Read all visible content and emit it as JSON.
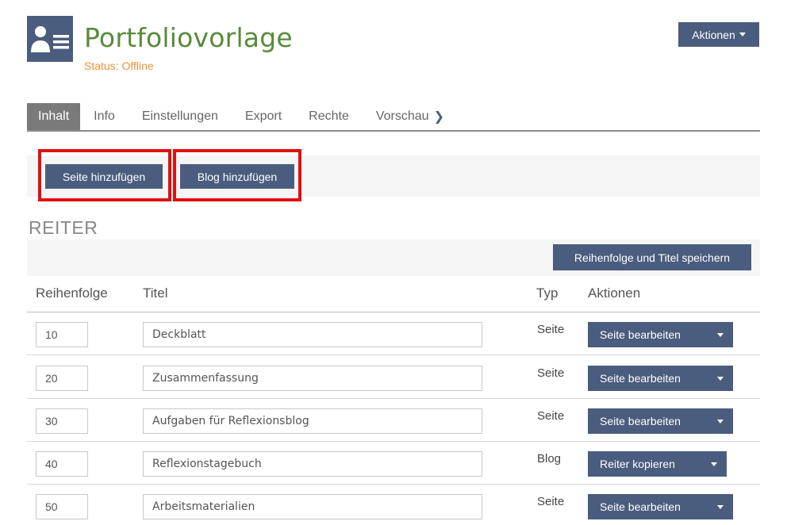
{
  "header": {
    "title": "Portfoliovorlage",
    "status_label": "Status:",
    "status_value": "Offline",
    "actions_label": "Aktionen"
  },
  "tabs": [
    {
      "label": "Inhalt",
      "active": true
    },
    {
      "label": "Info"
    },
    {
      "label": "Einstellungen"
    },
    {
      "label": "Export"
    },
    {
      "label": "Rechte"
    },
    {
      "label": "Vorschau"
    }
  ],
  "toolbar": {
    "add_page_label": "Seite hinzufügen",
    "add_blog_label": "Blog hinzufügen"
  },
  "section": {
    "title": "REITER",
    "save_label": "Reihenfolge und Titel speichern"
  },
  "table": {
    "headers": {
      "order": "Reihenfolge",
      "title": "Titel",
      "type": "Typ",
      "actions": "Aktionen"
    },
    "rows": [
      {
        "order": "10",
        "title": "Deckblatt",
        "type": "Seite",
        "action": "Seite bearbeiten"
      },
      {
        "order": "20",
        "title": "Zusammenfassung",
        "type": "Seite",
        "action": "Seite bearbeiten"
      },
      {
        "order": "30",
        "title": "Aufgaben für Reflexionsblog",
        "type": "Seite",
        "action": "Seite bearbeiten"
      },
      {
        "order": "40",
        "title": "Reflexionstagebuch",
        "type": "Blog",
        "action": "Reiter kopieren"
      },
      {
        "order": "50",
        "title": "Arbeitsmaterialien",
        "type": "Seite",
        "action": "Seite bearbeiten"
      }
    ]
  },
  "colors": {
    "primary": "#4a5d7e",
    "title_green": "#5a8a3a",
    "status_orange": "#f0913c",
    "highlight_red": "#e01010"
  }
}
